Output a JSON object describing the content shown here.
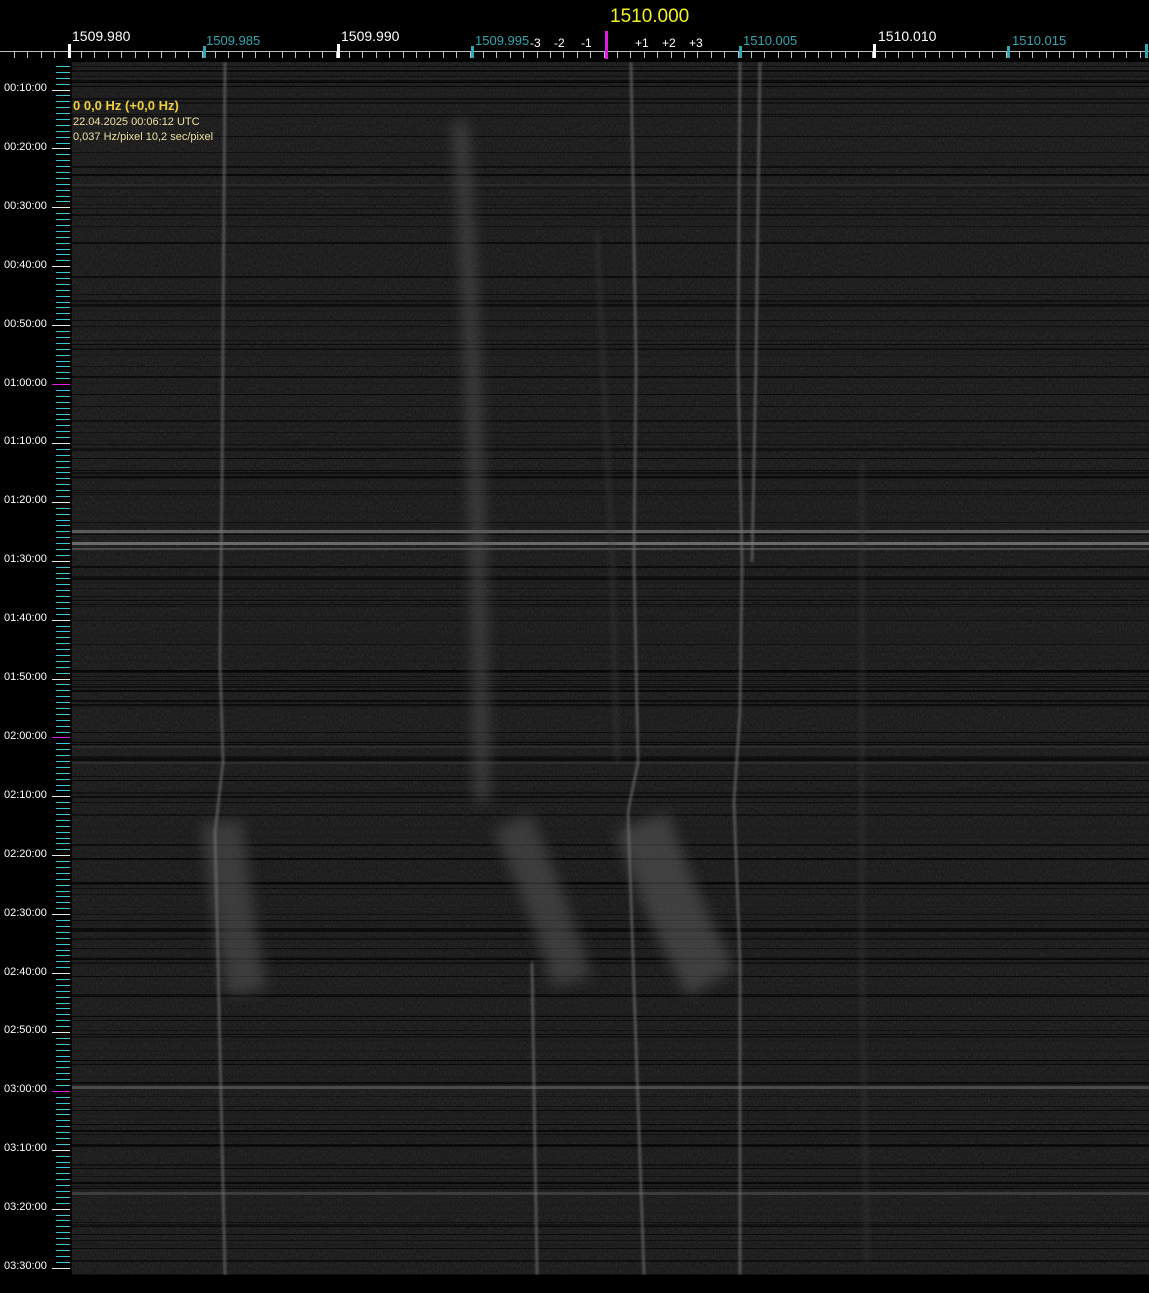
{
  "ruler": {
    "center_frequency": "1510.000",
    "labels": [
      {
        "text": "1509.980",
        "kind": "major"
      },
      {
        "text": "1509.985",
        "kind": "minor"
      },
      {
        "text": "1509.990",
        "kind": "major"
      },
      {
        "text": "1509.995",
        "kind": "minor"
      },
      {
        "text": "1510.005",
        "kind": "minor"
      },
      {
        "text": "1510.010",
        "kind": "major"
      },
      {
        "text": "1510.015",
        "kind": "minor"
      }
    ],
    "offsets": [
      "-3",
      "-2",
      "-1",
      "+1",
      "+2",
      "+3"
    ]
  },
  "info": {
    "offset": "0 0,0 Hz (+0,0 Hz)",
    "timestamp": "22.04.2025 00:06:12 UTC",
    "resolution": "0,037 Hz/pixel 10,2 sec/pixel"
  },
  "time_axis": {
    "labels": [
      "00:10:00",
      "00:20:00",
      "00:30:00",
      "00:40:00",
      "00:50:00",
      "01:00:00",
      "01:10:00",
      "01:20:00",
      "01:30:00",
      "01:40:00",
      "01:50:00",
      "02:00:00",
      "02:10:00",
      "02:20:00",
      "02:30:00",
      "02:40:00",
      "02:50:00",
      "03:00:00",
      "03:10:00",
      "03:20:00",
      "03:30:00"
    ]
  },
  "colors": {
    "background": "#000000",
    "center_marker": "#e01ce0",
    "center_label": "#f2f21c",
    "minor_label": "#2fa6b0",
    "time_tick": "#3ec6d6",
    "info_text": "#f0d040"
  }
}
